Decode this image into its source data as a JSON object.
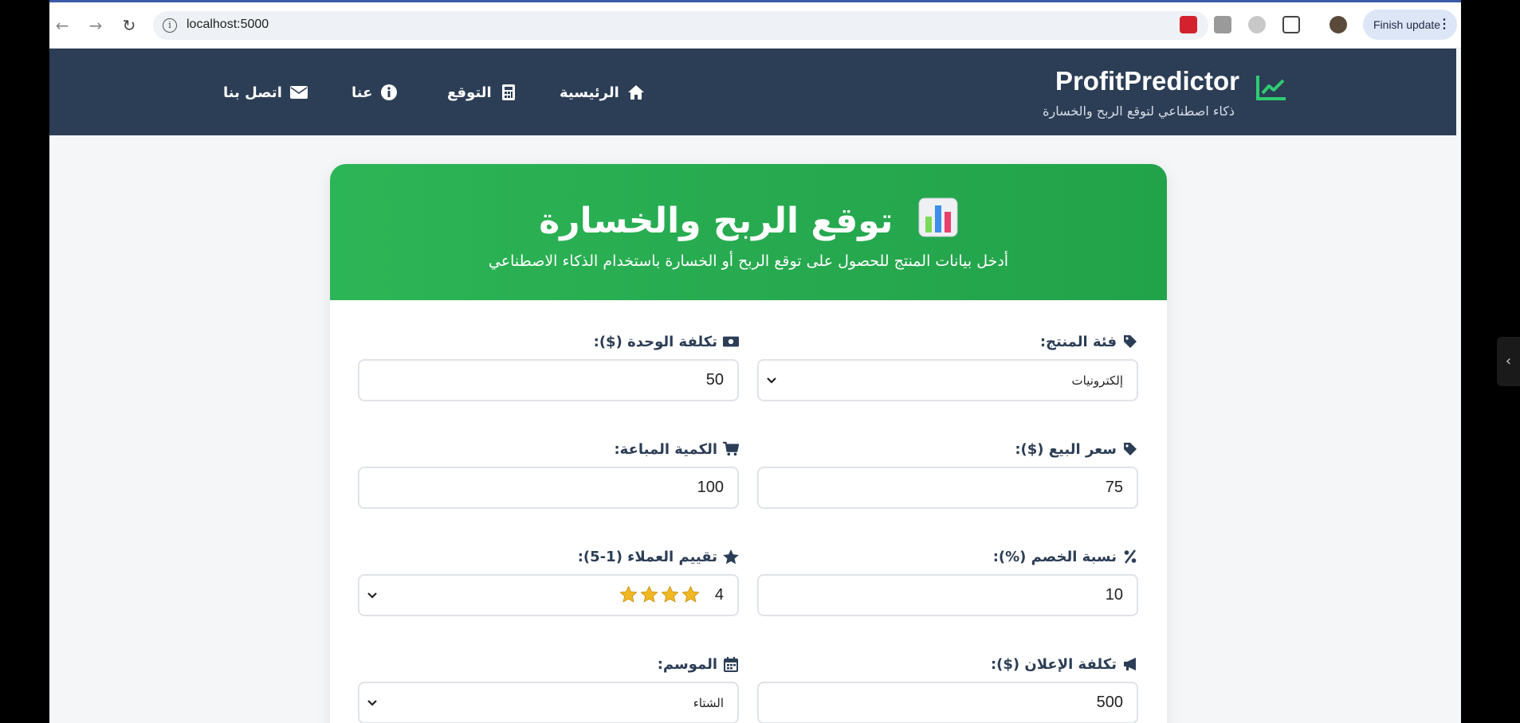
{
  "browser": {
    "url": "localhost:5000",
    "finish_update_label": "Finish update",
    "extension_colors": [
      "#d3222d",
      "#8a8a8a",
      "#9a9a9a",
      "#444444"
    ]
  },
  "header": {
    "brand": "ProfitPredictor",
    "tagline": "ذكاء اصطناعي لتوقع الربح والخسارة",
    "nav": [
      {
        "label": "الرئيسية",
        "icon": "home-icon"
      },
      {
        "label": "التوقع",
        "icon": "calculator-icon"
      },
      {
        "label": "عنا",
        "icon": "info-icon"
      },
      {
        "label": "اتصل بنا",
        "icon": "envelope-icon"
      }
    ],
    "accent_color": "#2ecc71"
  },
  "card": {
    "title": "توقع الربح والخسارة",
    "subtitle": "أدخل بيانات المنتج للحصول على توقع الربح أو الخسارة باستخدام الذكاء الاصطناعي",
    "header_color": "#27ae60"
  },
  "form": {
    "category": {
      "label": "فئة المنتج:",
      "value": "إلكترونيات"
    },
    "unit_cost": {
      "label": "تكلفة الوحدة ($):",
      "value": "50"
    },
    "sale_price": {
      "label": "سعر البيع ($):",
      "value": "75"
    },
    "quantity": {
      "label": "الكمية المباعة:",
      "value": "100"
    },
    "discount": {
      "label": "نسبة الخصم (%):",
      "value": "10"
    },
    "rating": {
      "label": "تقييم العملاء (1-5):",
      "value": "4",
      "stars": 4
    },
    "ad_cost": {
      "label": "تكلفة الإعلان ($):",
      "value": "500"
    },
    "season": {
      "label": "الموسم:",
      "value": "الشتاء"
    }
  }
}
